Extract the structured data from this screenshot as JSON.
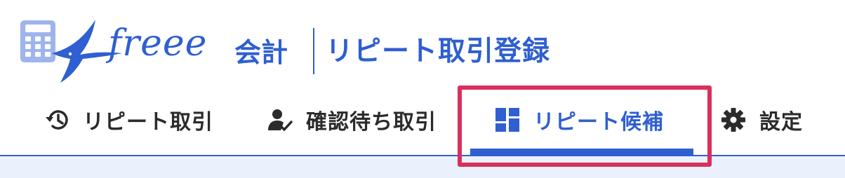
{
  "brand": {
    "logo_text": "freee",
    "product": "会計"
  },
  "header": {
    "page_title": "リピート取引登録"
  },
  "tabs": [
    {
      "label": "リピート取引",
      "icon": "history-icon",
      "active": false
    },
    {
      "label": "確認待ち取引",
      "icon": "user-check-icon",
      "active": false
    },
    {
      "label": "リピート候補",
      "icon": "dashboard-icon",
      "active": true
    },
    {
      "label": "設定",
      "icon": "gear-icon",
      "active": false
    }
  ],
  "colors": {
    "accent": "#2f5fd0",
    "highlight": "#d9305c",
    "text": "#2b2b2b",
    "content_bg": "#eaf1fd"
  }
}
